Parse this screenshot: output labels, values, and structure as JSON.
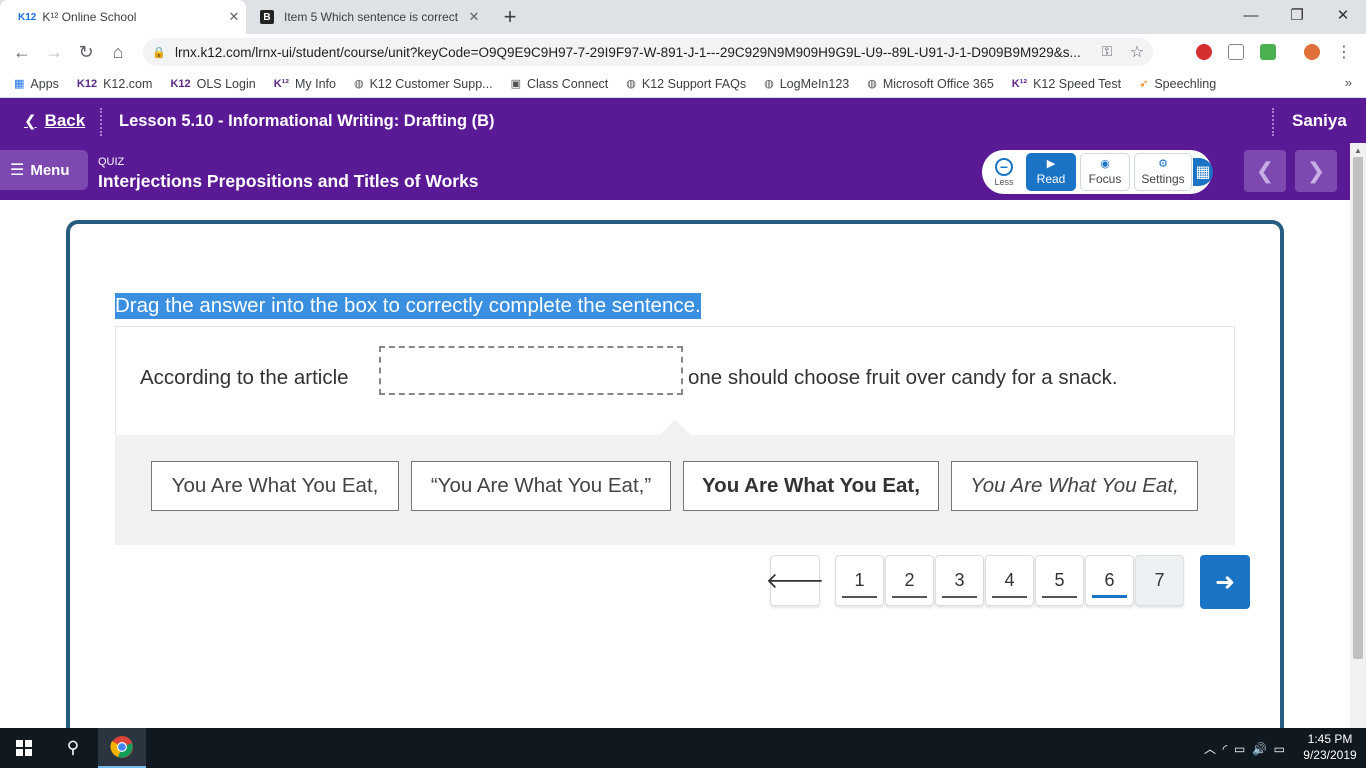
{
  "browser": {
    "tabs": [
      {
        "favicon": "K12",
        "title": "K¹² Online School",
        "active": true
      },
      {
        "favicon": "B",
        "title": "Item 5 Which sentence is correct",
        "active": false
      }
    ],
    "url": "lrnx.k12.com/lrnx-ui/student/course/unit?keyCode=O9Q9E9C9H97-7-29I9F97-W-891-J-1---29C929N9M909H9G9L-U9--89L-U91-J-1-D909B9M929&s...",
    "bookmarks": [
      {
        "icon": "apps-icon",
        "label": "Apps"
      },
      {
        "icon": "k12-icon",
        "label": "K12.com"
      },
      {
        "icon": "k12-icon",
        "label": "OLS Login"
      },
      {
        "icon": "k12-icon",
        "label": "My Info"
      },
      {
        "icon": "globe-icon",
        "label": "K12 Customer Supp..."
      },
      {
        "icon": "video-icon",
        "label": "Class Connect"
      },
      {
        "icon": "globe-icon",
        "label": "K12 Support FAQs"
      },
      {
        "icon": "globe-icon",
        "label": "LogMeIn123"
      },
      {
        "icon": "globe-icon",
        "label": "Microsoft Office 365"
      },
      {
        "icon": "k12-icon",
        "label": "K12 Speed Test"
      },
      {
        "icon": "rocket-icon",
        "label": "Speechling"
      }
    ]
  },
  "header": {
    "back_label": "Back",
    "lesson_title": "Lesson 5.10 - Informational Writing: Drafting (B)",
    "user_name": "Saniya",
    "menu_label": "Menu",
    "quiz_label": "QUIZ",
    "quiz_title": "Interjections Prepositions and Titles of Works",
    "tools": {
      "less_label": "Less",
      "read_label": "Read",
      "focus_label": "Focus",
      "settings_label": "Settings"
    }
  },
  "question": {
    "instruction": "Drag the answer into the box to correctly complete the sentence.",
    "sentence_before": "According to the article",
    "sentence_after": "one should choose fruit over candy for a snack.",
    "options": [
      {
        "text": "You Are What You Eat,",
        "style": "plain"
      },
      {
        "text": "“You Are What You Eat,”",
        "style": "quoted"
      },
      {
        "text": "You Are What You Eat,",
        "style": "bold"
      },
      {
        "text": "You Are What You Eat,",
        "style": "italic"
      }
    ]
  },
  "pagination": {
    "pages": [
      "1",
      "2",
      "3",
      "4",
      "5",
      "6",
      "7"
    ],
    "current": "6"
  },
  "taskbar": {
    "time": "1:45 PM",
    "date": "9/23/2019"
  },
  "colors": {
    "header_purple": "#5b1a95",
    "accent_blue": "#1a73c4",
    "card_border": "#255c80",
    "selection_blue": "#3a8fe0"
  }
}
